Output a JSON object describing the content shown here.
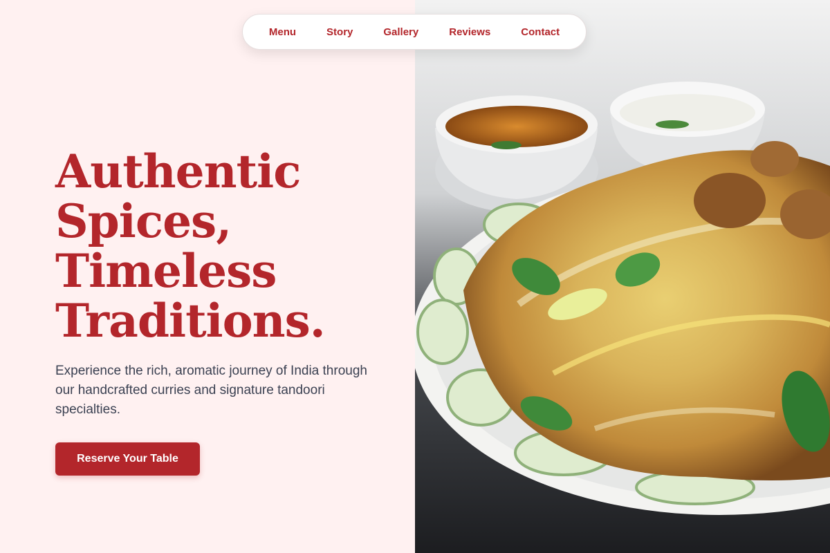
{
  "nav": {
    "items": [
      "Menu",
      "Story",
      "Gallery",
      "Reviews",
      "Contact"
    ]
  },
  "hero": {
    "headline_lines": [
      "Authentic",
      "Spices,",
      "Timeless",
      "Traditions."
    ],
    "subtitle": "Experience the rich, aromatic journey of India through our handcrafted curries and signature tandoori specialties.",
    "cta_label": "Reserve Your Table"
  },
  "colors": {
    "brand": "#b3262b",
    "background": "#fff1f1",
    "text": "#3b4152"
  }
}
